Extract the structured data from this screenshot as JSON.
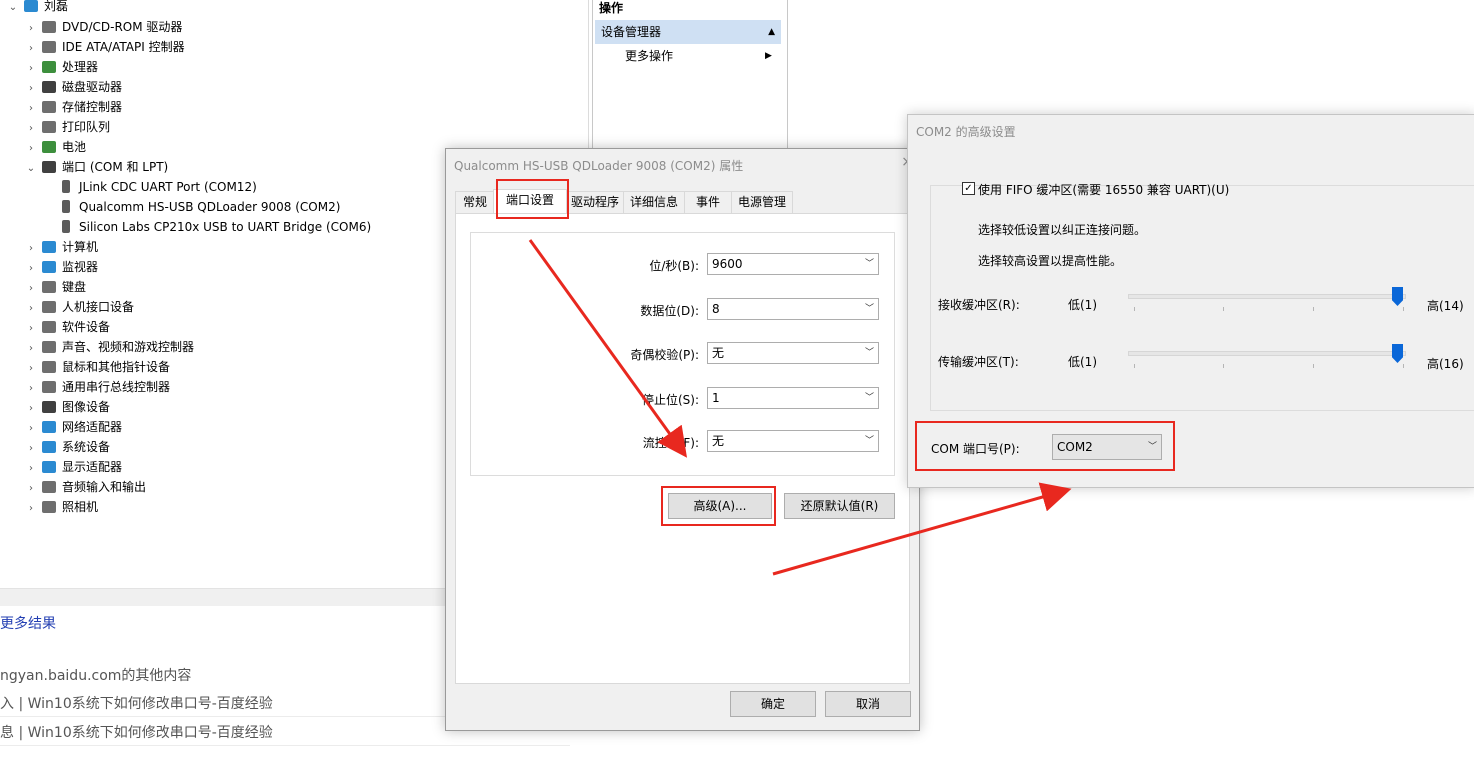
{
  "device_manager": {
    "root": "刘磊",
    "categories": [
      {
        "label": "DVD/CD-ROM 驱动器",
        "expanded": false
      },
      {
        "label": "IDE ATA/ATAPI 控制器",
        "expanded": false
      },
      {
        "label": "处理器",
        "expanded": false
      },
      {
        "label": "磁盘驱动器",
        "expanded": false
      },
      {
        "label": "存储控制器",
        "expanded": false
      },
      {
        "label": "打印队列",
        "expanded": false
      },
      {
        "label": "电池",
        "expanded": false
      },
      {
        "label": "端口 (COM 和 LPT)",
        "expanded": true
      },
      {
        "label": "计算机",
        "expanded": false
      },
      {
        "label": "监视器",
        "expanded": false
      },
      {
        "label": "键盘",
        "expanded": false
      },
      {
        "label": "人机接口设备",
        "expanded": false
      },
      {
        "label": "软件设备",
        "expanded": false
      },
      {
        "label": "声音、视频和游戏控制器",
        "expanded": false
      },
      {
        "label": "鼠标和其他指针设备",
        "expanded": false
      },
      {
        "label": "通用串行总线控制器",
        "expanded": false
      },
      {
        "label": "图像设备",
        "expanded": false
      },
      {
        "label": "网络适配器",
        "expanded": false
      },
      {
        "label": "系统设备",
        "expanded": false
      },
      {
        "label": "显示适配器",
        "expanded": false
      },
      {
        "label": "音频输入和输出",
        "expanded": false
      },
      {
        "label": "照相机",
        "expanded": false
      }
    ],
    "ports": [
      "JLink CDC UART Port (COM12)",
      "Qualcomm HS-USB QDLoader 9008 (COM2)",
      "Silicon Labs CP210x USB to UART Bridge (COM6)"
    ]
  },
  "actions": {
    "header": "操作",
    "section": "设备管理器",
    "more": "更多操作"
  },
  "web": {
    "more_results": "更多结果",
    "other_content": "ngyan.baidu.com的其他内容",
    "result1": "入 | Win10系统下如何修改串口号-百度经验",
    "result2": "息 | Win10系统下如何修改串口号-百度经验"
  },
  "properties": {
    "title": "Qualcomm HS-USB QDLoader 9008 (COM2) 属性",
    "close": "×",
    "tabs": [
      "常规",
      "端口设置",
      "驱动程序",
      "详细信息",
      "事件",
      "电源管理"
    ],
    "active_tab": "端口设置",
    "fields": [
      {
        "label": "位/秒(B):",
        "value": "9600"
      },
      {
        "label": "数据位(D):",
        "value": "8"
      },
      {
        "label": "奇偶校验(P):",
        "value": "无"
      },
      {
        "label": "停止位(S):",
        "value": "1"
      },
      {
        "label": "流控制(F):",
        "value": "无"
      }
    ],
    "advanced_button": "高级(A)...",
    "restore_button": "还原默认值(R)",
    "ok_button": "确定",
    "cancel_button": "取消"
  },
  "advanced": {
    "title": "COM2 的高级设置",
    "fifo_label": "使用 FIFO 缓冲区(需要 16550 兼容 UART)(U)",
    "fifo_checked": true,
    "hint_low": "选择较低设置以纠正连接问题。",
    "hint_high": "选择较高设置以提高性能。",
    "receive_label": "接收缓冲区(R):",
    "receive_low": "低(1)",
    "receive_high": "高(14)",
    "receive_level": 1.0,
    "transmit_label": "传输缓冲区(T):",
    "transmit_low": "低(1)",
    "transmit_high": "高(16)",
    "transmit_level": 1.0,
    "com_label": "COM 端口号(P):",
    "com_value": "COM2"
  },
  "colors": {
    "highlight_red": "#e8281f",
    "selection_blue": "#cfe0f3",
    "slider_blue": "#0a67d8"
  }
}
